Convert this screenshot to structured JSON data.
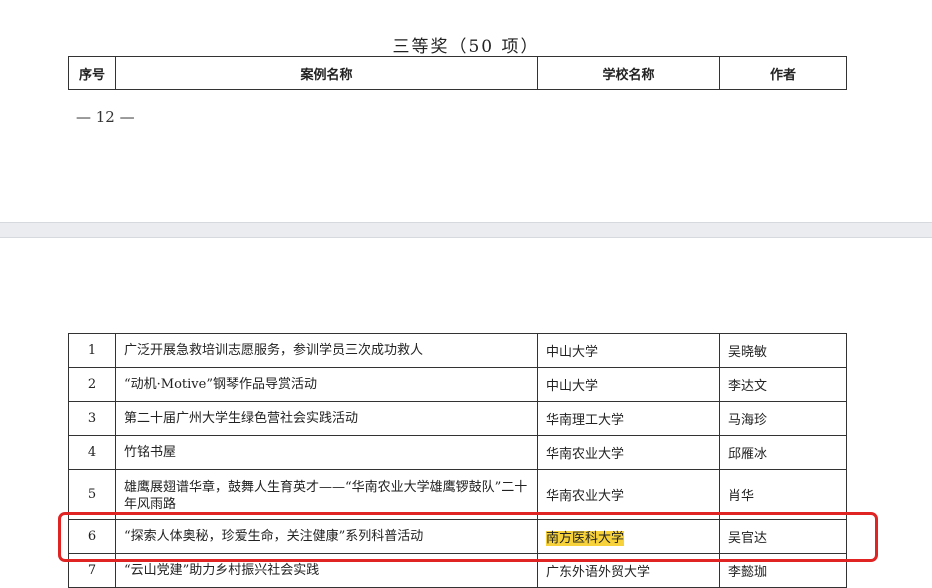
{
  "section_title": "三等奖（50 项）",
  "header": [
    "序号",
    "案例名称",
    "学校名称",
    "作者"
  ],
  "page_number": "— 12 —",
  "rows": [
    {
      "no": "1",
      "case": "广泛开展急救培训志愿服务，参训学员三次成功救人",
      "school": "中山大学",
      "author": "吴晓敏"
    },
    {
      "no": "2",
      "case": "“动机·Motive”钢琴作品导赏活动",
      "school": "中山大学",
      "author": "李达文"
    },
    {
      "no": "3",
      "case": "第二十届广州大学生绿色营社会实践活动",
      "school": "华南理工大学",
      "author": "马海珍"
    },
    {
      "no": "4",
      "case": "竹铭书屋",
      "school": "华南农业大学",
      "author": "邱雁冰"
    },
    {
      "no": "5",
      "case": "雄鹰展翅谱华章，鼓舞人生育英才——“华南农业大学雄鹰锣鼓队”二十年风雨路",
      "school": "华南农业大学",
      "author": "肖华"
    },
    {
      "no": "6",
      "case": "“探索人体奥秘，珍爱生命，关注健康”系列科普活动",
      "school": "南方医科大学",
      "author": "吴官达"
    },
    {
      "no": "7",
      "case": "“云山党建”助力乡村振兴社会实践",
      "school": "广东外语外贸大学",
      "author": "李懿珈"
    }
  ]
}
